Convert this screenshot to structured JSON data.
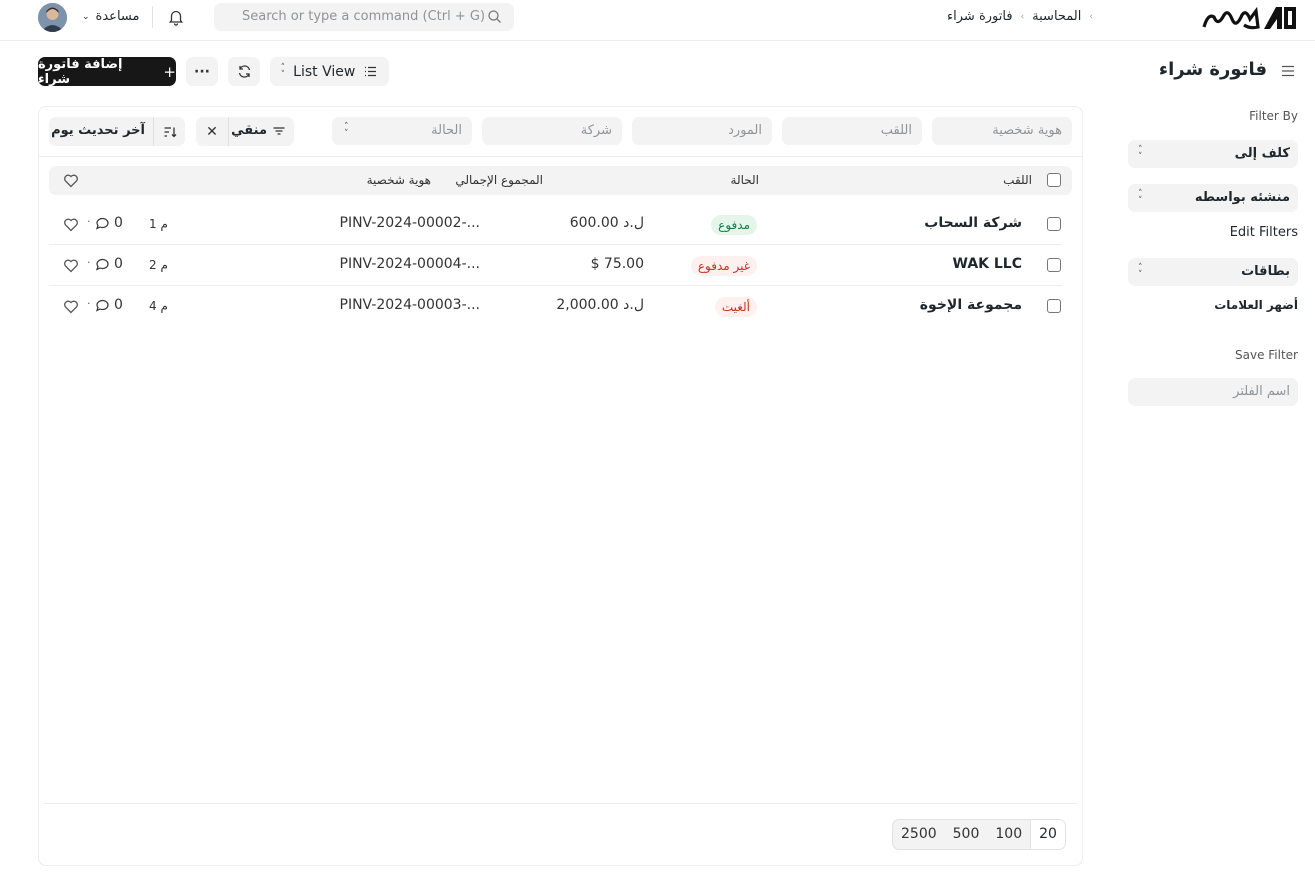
{
  "navbar": {
    "help_label": "مساعدة",
    "search_placeholder": "Search or type a command (Ctrl + G)",
    "breadcrumbs": [
      "المحاسبة",
      "فاتورة شراء"
    ]
  },
  "page": {
    "title": "فاتورة شراء",
    "add_button": "إضافة فاتورة شراء",
    "more_button": "···",
    "view_label": "List View"
  },
  "filters": {
    "id_placeholder": "هوية شخصية",
    "title_placeholder": "اللقب",
    "supplier_placeholder": "المورد",
    "company_placeholder": "شركة",
    "status_placeholder": "الحالة",
    "filtered_label": "منقي",
    "sort_label": "آخر تحديث يوم"
  },
  "list": {
    "headers": {
      "title": "اللقب",
      "status": "الحالة",
      "total": "المجموع الإجمالي",
      "id": "هوية شخصية"
    },
    "rows": [
      {
        "title": "شركة السحاب",
        "status": "مدفوع",
        "status_kind": "paid",
        "amount": "ل.د 600.00",
        "id": "PINV-2024-00002-...",
        "time": "1 م",
        "comments": "0"
      },
      {
        "title": "WAK LLC",
        "status": "غير مدفوع",
        "status_kind": "unpaid",
        "amount": "$ 75.00",
        "id": "PINV-2024-00004-...",
        "time": "2 م",
        "comments": "0"
      },
      {
        "title": "مجموعة الإخوة",
        "status": "ألغيت",
        "status_kind": "cancel",
        "amount": "ل.د 2,000.00",
        "id": "PINV-2024-00003-...",
        "time": "4 م",
        "comments": "0"
      }
    ]
  },
  "pager": [
    "2500",
    "500",
    "100",
    "20"
  ],
  "sidebar": {
    "filter_by": "Filter By",
    "assigned_to": "كلف إلى",
    "created_by": "منشئه بواسطه",
    "edit_filters": "Edit Filters",
    "tags": "بطاقات",
    "popular_tags": "أضهر العلامات",
    "save_filter": "Save Filter",
    "filter_name_placeholder": "اسم الفلتر"
  }
}
